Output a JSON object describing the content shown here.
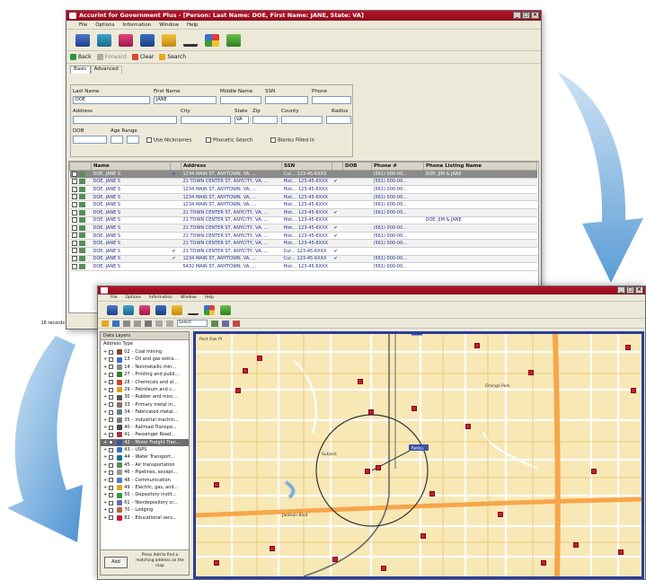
{
  "search_window": {
    "title": "Accurint for Government Plus - [Person: Last Name: DOE, First Name: JANE, State: VA]",
    "menu": [
      "File",
      "Options",
      "Information",
      "Window",
      "Help"
    ],
    "nav": {
      "back": "Back",
      "forward": "Forward",
      "clear": "Clear",
      "search": "Search"
    },
    "tabs": [
      "Basic",
      "Advanced"
    ],
    "form": {
      "last_name_label": "Last Name",
      "last_name_value": "DOE",
      "first_name_label": "First Name",
      "first_name_value": "JANE",
      "middle_name_label": "Middle Name",
      "ssn_label": "SSN",
      "phone_label": "Phone",
      "address_label": "Address",
      "city_label": "City",
      "state_label": "State",
      "state_value": "VA",
      "zip_label": "Zip",
      "county_label": "County",
      "radius_label": "Radius",
      "dob_label": "DOB",
      "age_range_label": "Age Range",
      "use_nicknames": "Use Nicknames",
      "phonetic_search": "Phonetic Search",
      "blanks_filled": "Blanks Filled In"
    },
    "table": {
      "columns": [
        "Name",
        "Address",
        "SSN",
        "DOB",
        "Phone #",
        "Phone Listing Name"
      ],
      "rows": [
        {
          "name": "DOE, JANE S",
          "check": true,
          "address": "1234 MAIN ST, ANYTOWN, VA, ...",
          "type": "Cur...",
          "ssn": "123-45-6XXX",
          "ssn_check": false,
          "phone": "(561) 000-00...",
          "listing": "DOE, JIM & JANE",
          "selected": true
        },
        {
          "name": "DOE, JANE S",
          "check": false,
          "address": "21 TOWN CENTER ST, ANYCITY, VA, ...",
          "type": "Hist...",
          "ssn": "123-45-6XXX",
          "ssn_check": true,
          "phone": "(561) 000-00...",
          "listing": "",
          "selected": false
        },
        {
          "name": "DOE, JANE S",
          "check": false,
          "address": "1234 MAIN ST, ANYTOWN, VA, ...",
          "type": "Hist...",
          "ssn": "123-45-6XXX",
          "ssn_check": false,
          "phone": "(561) 000-00...",
          "listing": "",
          "selected": false
        },
        {
          "name": "DOE, JANE S",
          "check": false,
          "address": "1234 MAIN ST, ANYTOWN, VA, ...",
          "type": "Hist...",
          "ssn": "123-45-6XXX",
          "ssn_check": false,
          "phone": "(561) 000-00...",
          "listing": "",
          "selected": false
        },
        {
          "name": "DOE, JANE S",
          "check": false,
          "address": "1234 MAIN ST, ANYTOWN, VA, ...",
          "type": "Hist...",
          "ssn": "123-45-6XXX",
          "ssn_check": false,
          "phone": "(561) 000-00...",
          "listing": "",
          "selected": false
        },
        {
          "name": "DOE, JANE S",
          "check": false,
          "address": "21 TOWN CENTER ST, ANYCITY, VA, ...",
          "type": "Hist...",
          "ssn": "123-45-6XXX",
          "ssn_check": true,
          "phone": "(561) 000-00...",
          "listing": "",
          "selected": false
        },
        {
          "name": "DOE, JANE S",
          "check": false,
          "address": "21 TOWN CENTER ST, ANYCITY, VA, ...",
          "type": "Hist...",
          "ssn": "123-45-6XXX",
          "ssn_check": false,
          "phone": "",
          "listing": "DOE, JIM & JANE",
          "selected": false
        },
        {
          "name": "DOE, JANE S",
          "check": false,
          "address": "21 TOWN CENTER ST, ANYCITY, VA, ...",
          "type": "Hist...",
          "ssn": "123-45-6XXX",
          "ssn_check": true,
          "phone": "(561) 000-00...",
          "listing": "",
          "selected": false
        },
        {
          "name": "DOE, JANE S",
          "check": false,
          "address": "21 TOWN CENTER ST, ANYCITY, VA, ...",
          "type": "Hist...",
          "ssn": "123-45-6XXX",
          "ssn_check": true,
          "phone": "(561) 000-00...",
          "listing": "",
          "selected": false
        },
        {
          "name": "DOE, JANE S",
          "check": false,
          "address": "21 TOWN CENTER ST, ANYCITY, VA, ...",
          "type": "Hist...",
          "ssn": "123-45-6XXX",
          "ssn_check": false,
          "phone": "(561) 000-00...",
          "listing": "",
          "selected": false
        },
        {
          "name": "DOE, JANE S",
          "check": true,
          "address": "21 TOWN CENTER ST, ANYCITY, VA, ...",
          "type": "Cur...",
          "ssn": "123-45-6XXX",
          "ssn_check": true,
          "phone": "",
          "listing": "",
          "selected": false
        },
        {
          "name": "DOE, JANE S",
          "check": true,
          "address": "1234 MAIN ST, ANYTOWN, VA, ...",
          "type": "Cur...",
          "ssn": "123-45-6XXX",
          "ssn_check": true,
          "phone": "(561) 000-00...",
          "listing": "",
          "selected": false
        },
        {
          "name": "DOE, JANE S",
          "check": false,
          "address": "5432 MAIN ST, ANYTOWN, VA, ...",
          "type": "Hist...",
          "ssn": "123-45-6XXX",
          "ssn_check": false,
          "phone": "(561) 000-00...",
          "listing": "",
          "selected": false
        }
      ]
    },
    "status": "16 records"
  },
  "map_window": {
    "menu": [
      "File",
      "Options",
      "Information",
      "Window",
      "Help"
    ],
    "zoom_select": "Select",
    "layers_title": "Data Layers",
    "layer_group": "Address Type",
    "layers": [
      {
        "code": "02",
        "name": "Coal mining",
        "selected": false
      },
      {
        "code": "13",
        "name": "Oil and gas extra...",
        "selected": false
      },
      {
        "code": "14",
        "name": "Nonmetallic min...",
        "selected": false
      },
      {
        "code": "27",
        "name": "Printing and publi...",
        "selected": false
      },
      {
        "code": "28",
        "name": "Chemicals and al...",
        "selected": false
      },
      {
        "code": "29",
        "name": "Petroleum and c...",
        "selected": false
      },
      {
        "code": "30",
        "name": "Rubber and misc...",
        "selected": false
      },
      {
        "code": "33",
        "name": "Primary metal in...",
        "selected": false
      },
      {
        "code": "34",
        "name": "Fabricated metal...",
        "selected": false
      },
      {
        "code": "35",
        "name": "Industrial machin...",
        "selected": false
      },
      {
        "code": "40",
        "name": "Railroad Transpo...",
        "selected": false
      },
      {
        "code": "41",
        "name": "Passenger Road...",
        "selected": false
      },
      {
        "code": "42",
        "name": "Motor Freight Tran...",
        "selected": true
      },
      {
        "code": "43",
        "name": "USPS",
        "selected": false
      },
      {
        "code": "44",
        "name": "Water Transport...",
        "selected": false
      },
      {
        "code": "45",
        "name": "Air transportation",
        "selected": false
      },
      {
        "code": "46",
        "name": "Pipelines, except...",
        "selected": false
      },
      {
        "code": "48",
        "name": "Communication",
        "selected": false
      },
      {
        "code": "49",
        "name": "Electric, gas, and...",
        "selected": false
      },
      {
        "code": "50",
        "name": "Depository instit...",
        "selected": false
      },
      {
        "code": "61",
        "name": "Nondepository cr...",
        "selected": false
      },
      {
        "code": "70",
        "name": "Lodging",
        "selected": false
      },
      {
        "code": "82",
        "name": "Educational serv...",
        "selected": false
      }
    ],
    "add_button": "Add",
    "hint": "Press Add to find a matching address on the map",
    "map_labels": {
      "north_st": "Post Oak Pl",
      "jackson": "Jackson Blvd",
      "orange_park": "Orange Park",
      "target": "Subject"
    }
  }
}
